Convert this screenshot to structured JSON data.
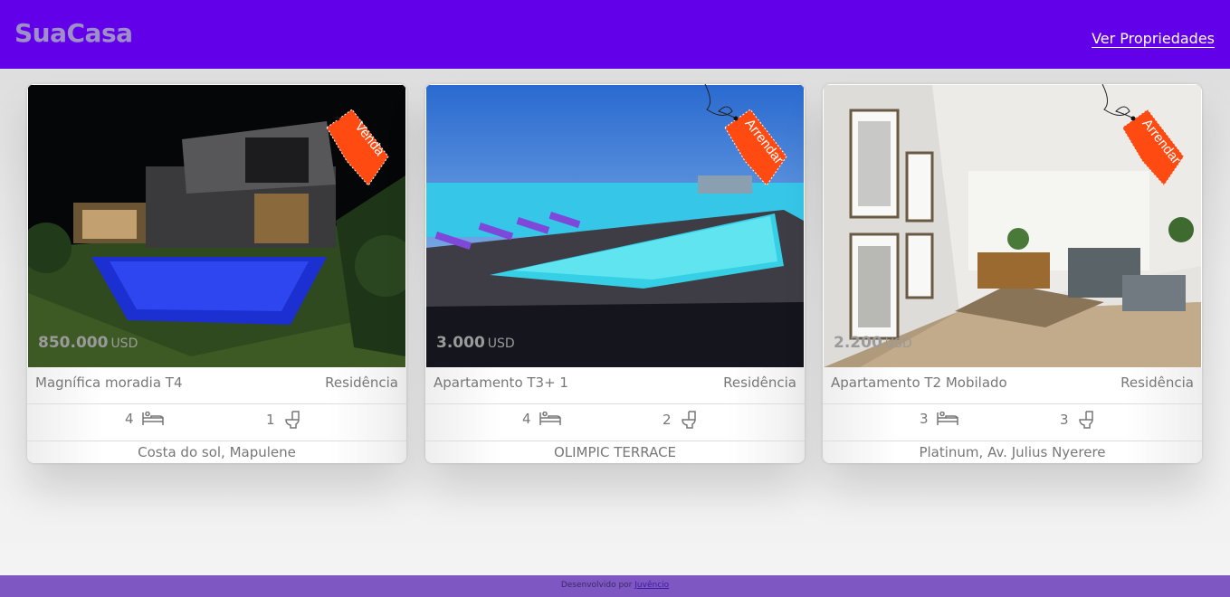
{
  "header": {
    "logo": "SuaCasa",
    "nav_link": "Ver Propriedades"
  },
  "listings": [
    {
      "price": "850.000",
      "currency": "USD",
      "tag": "Venda",
      "title": "Magnífica moradia T4",
      "type": "Residência",
      "bedrooms": "4",
      "bathrooms": "1",
      "location": "Costa do sol, Mapulene"
    },
    {
      "price": "3.000",
      "currency": "USD",
      "tag": "Arrendar",
      "title": "Apartamento T3+ 1",
      "type": "Residência",
      "bedrooms": "4",
      "bathrooms": "2",
      "location": "OLIMPIC TERRACE"
    },
    {
      "price": "2.200",
      "currency": "USD",
      "tag": "Arrendar",
      "title": "Apartamento T2 Mobilado",
      "type": "Residência",
      "bedrooms": "3",
      "bathrooms": "3",
      "location": "Platinum, Av. Julius Nyerere"
    }
  ],
  "footer": {
    "text": "Desenvolvido por",
    "author_link": "Juvêncio"
  },
  "icons": {
    "bedroom": "bed-icon",
    "bathroom": "toilet-icon"
  },
  "colors": {
    "header": "#6200ea",
    "footer": "#7e57c2",
    "tag": "#ff4a12"
  }
}
